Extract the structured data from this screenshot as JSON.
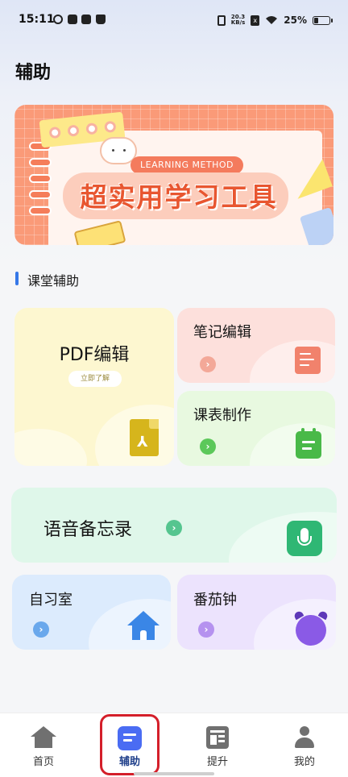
{
  "status_bar": {
    "time": "15:11",
    "net_speed_value": "20.3",
    "net_speed_unit": "KB/s",
    "battery_text": "25%",
    "battery_level": 0.25
  },
  "header": {
    "title": "辅助"
  },
  "banner": {
    "badge": "LEARNING METHOD",
    "title": "超实用学习工具"
  },
  "section": {
    "title": "课堂辅助"
  },
  "tools": {
    "pdf": {
      "label": "PDF编辑",
      "sub": "立即了解",
      "icon": "pdf-file-icon"
    },
    "note": {
      "label": "笔记编辑",
      "icon": "note-edit-icon"
    },
    "schedule": {
      "label": "课表制作",
      "icon": "calendar-icon"
    },
    "voice": {
      "label": "语音备忘录",
      "icon": "microphone-icon"
    },
    "study": {
      "label": "自习室",
      "icon": "house-icon"
    },
    "pomodoro": {
      "label": "番茄钟",
      "icon": "alarm-clock-icon"
    }
  },
  "nav": {
    "items": [
      {
        "label": "首页",
        "icon": "home-icon"
      },
      {
        "label": "辅助",
        "icon": "document-icon"
      },
      {
        "label": "提升",
        "icon": "dashboard-icon"
      },
      {
        "label": "我的",
        "icon": "person-icon"
      }
    ],
    "active_index": 1
  },
  "colors": {
    "accent": "#4a6cf3",
    "highlight": "#d41f2a",
    "section_bar": "#3678e8"
  }
}
